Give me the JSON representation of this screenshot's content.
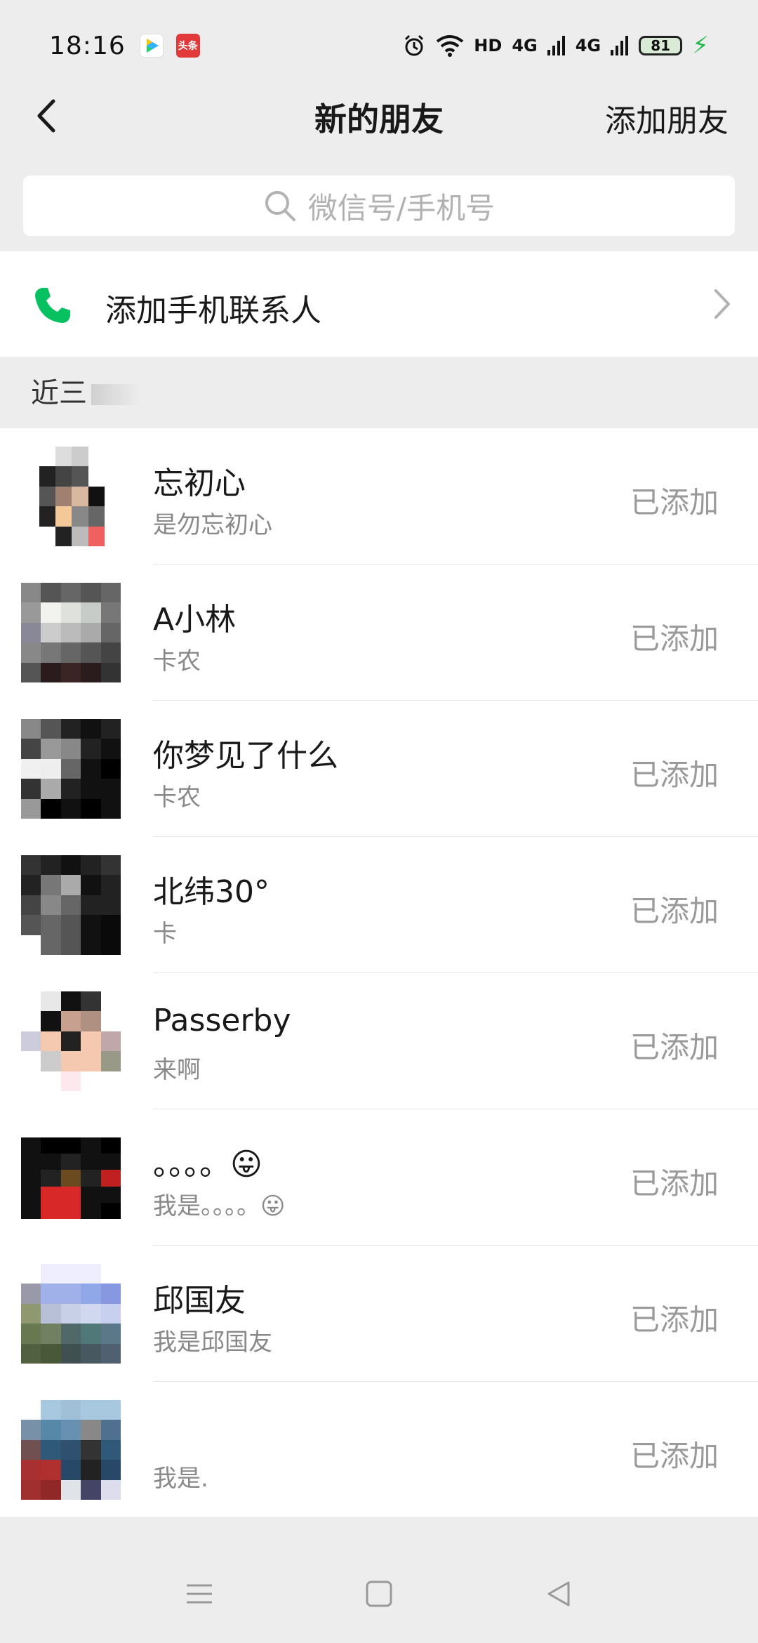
{
  "status_bar": {
    "time": "18:16",
    "news_badge": "头条",
    "network": "HD",
    "signal1": "4G",
    "signal2": "4G",
    "battery": "81"
  },
  "nav": {
    "title": "新的朋友",
    "action": "添加朋友"
  },
  "search": {
    "placeholder": "微信号/手机号"
  },
  "add_contacts": {
    "label": "添加手机联系人"
  },
  "section": {
    "label": "近三"
  },
  "friends": [
    {
      "name": "忘初心",
      "message": "是勿忘初心",
      "status": "已添加"
    },
    {
      "name": "A小林",
      "message": "卡农",
      "status": "已添加"
    },
    {
      "name": "你梦见了什么",
      "message": "卡农",
      "status": "已添加"
    },
    {
      "name": "北纬30°",
      "message": "卡",
      "status": "已添加"
    },
    {
      "name": "Passerby",
      "message": "来啊",
      "status": "已添加"
    },
    {
      "name": "。。。。😛",
      "message": "我是。。。。😛",
      "status": "已添加"
    },
    {
      "name": "邱国友",
      "message": "我是邱国友",
      "status": "已添加"
    },
    {
      "name": "",
      "message": "我是.",
      "status": "已添加"
    }
  ],
  "colors": {
    "accent_green": "#07c160",
    "background": "#ededed"
  }
}
